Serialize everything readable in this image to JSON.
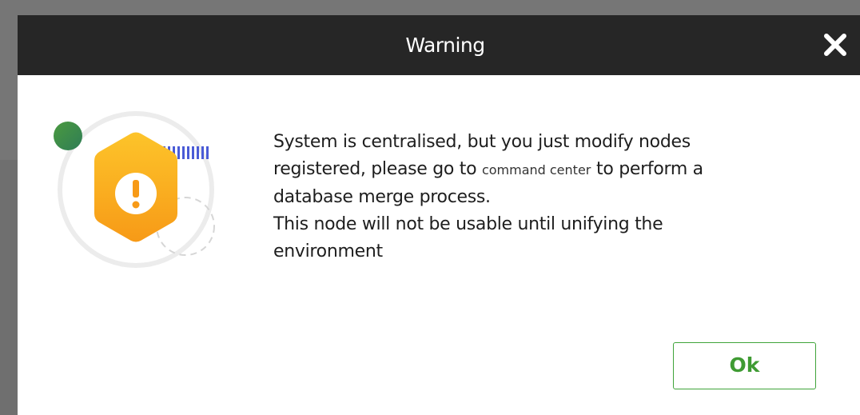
{
  "dialog": {
    "title": "Warning",
    "close_icon": "close-icon",
    "illustration_icon": "warning-hexagon-icon",
    "message": {
      "line1": "System is centralised, but you just modify nodes",
      "line2_before": "registered, please go to ",
      "line2_link": "command center",
      "line2_after": " to perform a",
      "line3": "database merge process.",
      "line4": "This node will not be usable until unifying the",
      "line5": "environment"
    },
    "ok_label": "Ok"
  },
  "colors": {
    "titlebar": "#262626",
    "ok_accent": "#3f9b33",
    "warning_orange": "#f9a11b",
    "dot_green": "#3f8f4a",
    "stripes_blue": "#4a5bd6"
  }
}
